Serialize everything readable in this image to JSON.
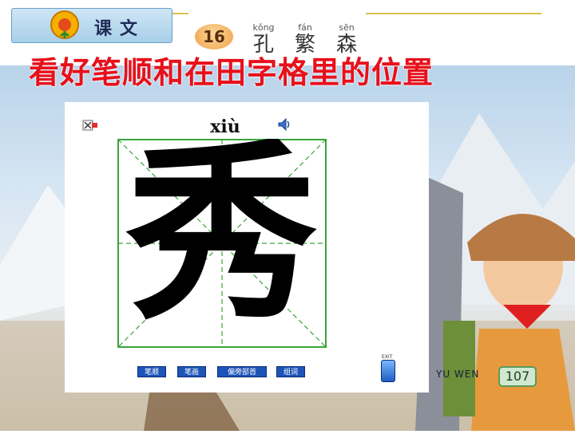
{
  "header": {
    "lesson_label": "课文",
    "lesson_number": "16",
    "title": [
      {
        "pinyin": "kǒng",
        "hanzi": "孔"
      },
      {
        "pinyin": "fán",
        "hanzi": "繁"
      },
      {
        "pinyin": "sēn",
        "hanzi": "森"
      }
    ]
  },
  "instruction": "看好笔顺和在田字格里的位置",
  "writer": {
    "pinyin": "xiù",
    "character": "秀",
    "buttons": [
      "笔顺",
      "笔画",
      "偏旁部首",
      "组词"
    ],
    "exit_label": "EXIT"
  },
  "footer": {
    "book": "YU WEN",
    "page": "107"
  },
  "colors": {
    "instruction": "#e8101a",
    "grid_border": "#3aa33a",
    "button": "#1c54b8"
  }
}
